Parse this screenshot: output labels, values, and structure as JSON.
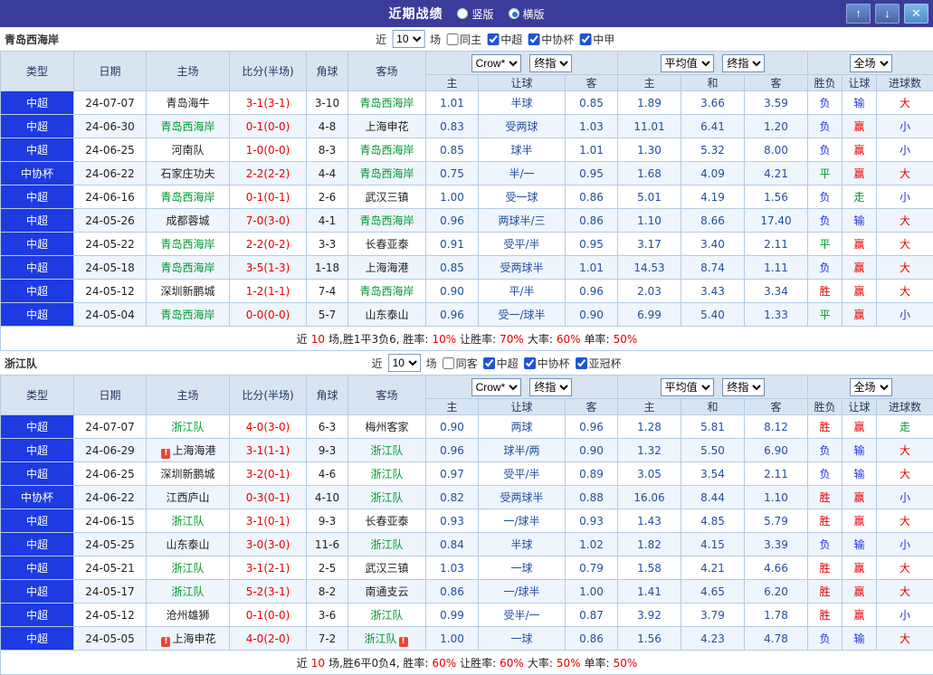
{
  "topbar": {
    "title": "近期战绩",
    "vertical_label": "竖版",
    "horizontal_label": "横版",
    "selected_layout": "横版",
    "up_icon": "↑",
    "down_icon": "↓",
    "close_icon": "✕"
  },
  "columns": {
    "type": "类型",
    "date": "日期",
    "home": "主场",
    "score": "比分(半场)",
    "corner": "角球",
    "away": "客场",
    "odds_home": "主",
    "odds_handicap": "让球",
    "odds_away": "客",
    "avg_home": "主",
    "avg_draw": "和",
    "avg_away": "客",
    "result": "胜负",
    "handicap_result": "让球",
    "goals": "进球数"
  },
  "colors": {
    "win": "#e60000",
    "draw": "#009933",
    "lose": "#2333dd",
    "focus_team": "#009933",
    "league_bg": "#1d3be0"
  },
  "sections": [
    {
      "team": "青岛西海岸",
      "filters": {
        "near": "近",
        "count": "10",
        "games": "场",
        "checks": [
          {
            "label": "同主",
            "checked": false
          },
          {
            "label": "中超",
            "checked": true
          },
          {
            "label": "中协杯",
            "checked": true
          },
          {
            "label": "中甲",
            "checked": true
          }
        ]
      },
      "dropdowns": {
        "company": "Crow*",
        "stage1": "终指",
        "avg": "平均值",
        "stage2": "终指",
        "scope": "全场"
      },
      "rows": [
        {
          "league": "中超",
          "date": "24-07-07",
          "home": "青岛海牛",
          "score": "3-1(3-1)",
          "corner": "3-10",
          "away": "青岛西海岸",
          "away_focus": true,
          "o_home": "1.01",
          "o_hcp": "半球",
          "o_away": "0.85",
          "a_home": "1.89",
          "a_draw": "3.66",
          "a_away": "3.59",
          "res": "负",
          "hres": "输",
          "gres": "大"
        },
        {
          "league": "中超",
          "date": "24-06-30",
          "home": "青岛西海岸",
          "home_focus": true,
          "score": "0-1(0-0)",
          "corner": "4-8",
          "away": "上海申花",
          "o_home": "0.83",
          "o_hcp": "受两球",
          "o_away": "1.03",
          "a_home": "11.01",
          "a_draw": "6.41",
          "a_away": "1.20",
          "res": "负",
          "hres": "赢",
          "gres": "小"
        },
        {
          "league": "中超",
          "date": "24-06-25",
          "home": "河南队",
          "score": "1-0(0-0)",
          "corner": "8-3",
          "away": "青岛西海岸",
          "away_focus": true,
          "o_home": "0.85",
          "o_hcp": "球半",
          "o_away": "1.01",
          "a_home": "1.30",
          "a_draw": "5.32",
          "a_away": "8.00",
          "res": "负",
          "hres": "赢",
          "gres": "小"
        },
        {
          "league": "中协杯",
          "date": "24-06-22",
          "home": "石家庄功夫",
          "score": "2-2(2-2)",
          "corner": "4-4",
          "away": "青岛西海岸",
          "away_focus": true,
          "o_home": "0.75",
          "o_hcp": "半/一",
          "o_away": "0.95",
          "a_home": "1.68",
          "a_draw": "4.09",
          "a_away": "4.21",
          "res": "平",
          "hres": "赢",
          "gres": "大"
        },
        {
          "league": "中超",
          "date": "24-06-16",
          "home": "青岛西海岸",
          "home_focus": true,
          "score": "0-1(0-1)",
          "corner": "2-6",
          "away": "武汉三镇",
          "o_home": "1.00",
          "o_hcp": "受一球",
          "o_away": "0.86",
          "a_home": "5.01",
          "a_draw": "4.19",
          "a_away": "1.56",
          "res": "负",
          "hres": "走",
          "gres": "小"
        },
        {
          "league": "中超",
          "date": "24-05-26",
          "home": "成都蓉城",
          "score": "7-0(3-0)",
          "corner": "4-1",
          "away": "青岛西海岸",
          "away_focus": true,
          "o_home": "0.96",
          "o_hcp": "两球半/三",
          "o_away": "0.86",
          "a_home": "1.10",
          "a_draw": "8.66",
          "a_away": "17.40",
          "res": "负",
          "hres": "输",
          "gres": "大"
        },
        {
          "league": "中超",
          "date": "24-05-22",
          "home": "青岛西海岸",
          "home_focus": true,
          "score": "2-2(0-2)",
          "corner": "3-3",
          "away": "长春亚泰",
          "o_home": "0.91",
          "o_hcp": "受平/半",
          "o_away": "0.95",
          "a_home": "3.17",
          "a_draw": "3.40",
          "a_away": "2.11",
          "res": "平",
          "hres": "赢",
          "gres": "大"
        },
        {
          "league": "中超",
          "date": "24-05-18",
          "home": "青岛西海岸",
          "home_focus": true,
          "score": "3-5(1-3)",
          "corner": "1-18",
          "away": "上海海港",
          "o_home": "0.85",
          "o_hcp": "受两球半",
          "o_away": "1.01",
          "a_home": "14.53",
          "a_draw": "8.74",
          "a_away": "1.11",
          "res": "负",
          "hres": "赢",
          "gres": "大"
        },
        {
          "league": "中超",
          "date": "24-05-12",
          "home": "深圳新鹏城",
          "score": "1-2(1-1)",
          "corner": "7-4",
          "away": "青岛西海岸",
          "away_focus": true,
          "o_home": "0.90",
          "o_hcp": "平/半",
          "o_away": "0.96",
          "a_home": "2.03",
          "a_draw": "3.43",
          "a_away": "3.34",
          "res": "胜",
          "hres": "赢",
          "gres": "大"
        },
        {
          "league": "中超",
          "date": "24-05-04",
          "home": "青岛西海岸",
          "home_focus": true,
          "score": "0-0(0-0)",
          "corner": "5-7",
          "away": "山东泰山",
          "o_home": "0.96",
          "o_hcp": "受一/球半",
          "o_away": "0.90",
          "a_home": "6.99",
          "a_draw": "5.40",
          "a_away": "1.33",
          "res": "平",
          "hres": "赢",
          "gres": "小"
        }
      ],
      "summary": [
        {
          "t": "近",
          "c": "n"
        },
        {
          "t": "10",
          "c": "r"
        },
        {
          "t": "场,胜1平3负6, 胜率:",
          "c": "n"
        },
        {
          "t": "10%",
          "c": "r"
        },
        {
          "t": "让胜率:",
          "c": "n"
        },
        {
          "t": "70%",
          "c": "r"
        },
        {
          "t": "大率:",
          "c": "n"
        },
        {
          "t": "60%",
          "c": "r"
        },
        {
          "t": "单率:",
          "c": "n"
        },
        {
          "t": "50%",
          "c": "r"
        }
      ]
    },
    {
      "team": "浙江队",
      "filters": {
        "near": "近",
        "count": "10",
        "games": "场",
        "checks": [
          {
            "label": "同客",
            "checked": false
          },
          {
            "label": "中超",
            "checked": true
          },
          {
            "label": "中协杯",
            "checked": true
          },
          {
            "label": "亚冠杯",
            "checked": true
          }
        ]
      },
      "dropdowns": {
        "company": "Crow*",
        "stage1": "终指",
        "avg": "平均值",
        "stage2": "终指",
        "scope": "全场"
      },
      "rows": [
        {
          "league": "中超",
          "date": "24-07-07",
          "home": "浙江队",
          "home_focus": true,
          "score": "4-0(3-0)",
          "corner": "6-3",
          "away": "梅州客家",
          "o_home": "0.90",
          "o_hcp": "两球",
          "o_away": "0.96",
          "a_home": "1.28",
          "a_draw": "5.81",
          "a_away": "8.12",
          "res": "胜",
          "hres": "赢",
          "gres": "走"
        },
        {
          "league": "中超",
          "date": "24-06-29",
          "home": "上海海港",
          "home_badge": true,
          "score": "3-1(1-1)",
          "corner": "9-3",
          "away": "浙江队",
          "away_focus": true,
          "o_home": "0.96",
          "o_hcp": "球半/两",
          "o_away": "0.90",
          "a_home": "1.32",
          "a_draw": "5.50",
          "a_away": "6.90",
          "res": "负",
          "hres": "输",
          "gres": "大"
        },
        {
          "league": "中超",
          "date": "24-06-25",
          "home": "深圳新鹏城",
          "score": "3-2(0-1)",
          "corner": "4-6",
          "away": "浙江队",
          "away_focus": true,
          "o_home": "0.97",
          "o_hcp": "受平/半",
          "o_away": "0.89",
          "a_home": "3.05",
          "a_draw": "3.54",
          "a_away": "2.11",
          "res": "负",
          "hres": "输",
          "gres": "大"
        },
        {
          "league": "中协杯",
          "date": "24-06-22",
          "home": "江西庐山",
          "score": "0-3(0-1)",
          "corner": "4-10",
          "away": "浙江队",
          "away_focus": true,
          "o_home": "0.82",
          "o_hcp": "受两球半",
          "o_away": "0.88",
          "a_home": "16.06",
          "a_draw": "8.44",
          "a_away": "1.10",
          "res": "胜",
          "hres": "赢",
          "gres": "小"
        },
        {
          "league": "中超",
          "date": "24-06-15",
          "home": "浙江队",
          "home_focus": true,
          "score": "3-1(0-1)",
          "corner": "9-3",
          "away": "长春亚泰",
          "o_home": "0.93",
          "o_hcp": "一/球半",
          "o_away": "0.93",
          "a_home": "1.43",
          "a_draw": "4.85",
          "a_away": "5.79",
          "res": "胜",
          "hres": "赢",
          "gres": "大"
        },
        {
          "league": "中超",
          "date": "24-05-25",
          "home": "山东泰山",
          "score": "3-0(3-0)",
          "corner": "11-6",
          "away": "浙江队",
          "away_focus": true,
          "o_home": "0.84",
          "o_hcp": "半球",
          "o_away": "1.02",
          "a_home": "1.82",
          "a_draw": "4.15",
          "a_away": "3.39",
          "res": "负",
          "hres": "输",
          "gres": "小"
        },
        {
          "league": "中超",
          "date": "24-05-21",
          "home": "浙江队",
          "home_focus": true,
          "score": "3-1(2-1)",
          "corner": "2-5",
          "away": "武汉三镇",
          "o_home": "1.03",
          "o_hcp": "一球",
          "o_away": "0.79",
          "a_home": "1.58",
          "a_draw": "4.21",
          "a_away": "4.66",
          "res": "胜",
          "hres": "赢",
          "gres": "大"
        },
        {
          "league": "中超",
          "date": "24-05-17",
          "home": "浙江队",
          "home_focus": true,
          "score": "5-2(3-1)",
          "corner": "8-2",
          "away": "南通支云",
          "o_home": "0.86",
          "o_hcp": "一/球半",
          "o_away": "1.00",
          "a_home": "1.41",
          "a_draw": "4.65",
          "a_away": "6.20",
          "res": "胜",
          "hres": "赢",
          "gres": "大"
        },
        {
          "league": "中超",
          "date": "24-05-12",
          "home": "沧州雄狮",
          "score": "0-1(0-0)",
          "corner": "3-6",
          "away": "浙江队",
          "away_focus": true,
          "o_home": "0.99",
          "o_hcp": "受半/一",
          "o_away": "0.87",
          "a_home": "3.92",
          "a_draw": "3.79",
          "a_away": "1.78",
          "res": "胜",
          "hres": "赢",
          "gres": "小"
        },
        {
          "league": "中超",
          "date": "24-05-05",
          "home": "上海申花",
          "home_badge": true,
          "score": "4-0(2-0)",
          "corner": "7-2",
          "away": "浙江队",
          "away_focus": true,
          "away_badge": true,
          "o_home": "1.00",
          "o_hcp": "一球",
          "o_away": "0.86",
          "a_home": "1.56",
          "a_draw": "4.23",
          "a_away": "4.78",
          "res": "负",
          "hres": "输",
          "gres": "大"
        }
      ],
      "summary": [
        {
          "t": "近",
          "c": "n"
        },
        {
          "t": "10",
          "c": "r"
        },
        {
          "t": "场,胜6平0负4, 胜率:",
          "c": "n"
        },
        {
          "t": "60%",
          "c": "r"
        },
        {
          "t": "让胜率:",
          "c": "n"
        },
        {
          "t": "60%",
          "c": "r"
        },
        {
          "t": "大率:",
          "c": "n"
        },
        {
          "t": "50%",
          "c": "r"
        },
        {
          "t": "单率:",
          "c": "n"
        },
        {
          "t": "50%",
          "c": "r"
        }
      ]
    }
  ]
}
